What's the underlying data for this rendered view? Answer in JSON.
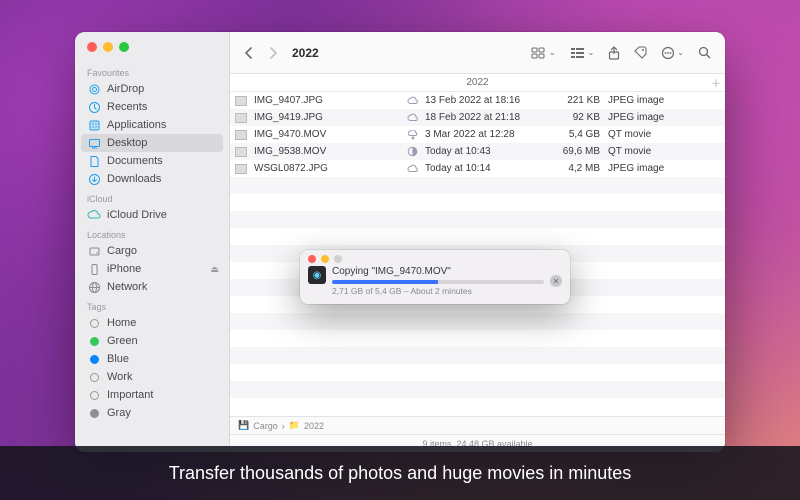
{
  "caption": "Transfer thousands of photos and huge movies in minutes",
  "window": {
    "title": "2022",
    "column_header": "2022"
  },
  "sidebar": {
    "sections": {
      "favourites": "Favourites",
      "icloud": "iCloud",
      "locations": "Locations",
      "tags": "Tags"
    },
    "favourites": [
      {
        "label": "AirDrop",
        "icon": "airdrop",
        "color": "#1a9ff1"
      },
      {
        "label": "Recents",
        "icon": "clock",
        "color": "#1a9ff1"
      },
      {
        "label": "Applications",
        "icon": "apps",
        "color": "#1a9ff1"
      },
      {
        "label": "Desktop",
        "icon": "desktop",
        "color": "#1a9ff1",
        "selected": true
      },
      {
        "label": "Documents",
        "icon": "doc",
        "color": "#1a9ff1"
      },
      {
        "label": "Downloads",
        "icon": "download",
        "color": "#1a9ff1"
      }
    ],
    "icloud": [
      {
        "label": "iCloud Drive",
        "icon": "cloud",
        "color": "#27b8b0"
      }
    ],
    "locations": [
      {
        "label": "Cargo",
        "icon": "disk",
        "color": "#8a8a8e"
      },
      {
        "label": "iPhone",
        "icon": "phone",
        "color": "#8a8a8e",
        "eject": true
      },
      {
        "label": "Network",
        "icon": "globe",
        "color": "#8a8a8e"
      }
    ],
    "tags": [
      {
        "label": "Home",
        "color": "transparent"
      },
      {
        "label": "Green",
        "color": "#34c759"
      },
      {
        "label": "Blue",
        "color": "#0a84ff"
      },
      {
        "label": "Work",
        "color": "transparent"
      },
      {
        "label": "Important",
        "color": "transparent"
      },
      {
        "label": "Gray",
        "color": "#8e8e93"
      }
    ]
  },
  "files": [
    {
      "name": "IMG_9407.JPG",
      "cloud": "cloud",
      "date": "13 Feb 2022 at 18:16",
      "size": "221 KB",
      "kind": "JPEG image"
    },
    {
      "name": "IMG_9419.JPG",
      "cloud": "cloud",
      "date": "18 Feb 2022 at 21:18",
      "size": "92 KB",
      "kind": "JPEG image"
    },
    {
      "name": "IMG_9470.MOV",
      "cloud": "down",
      "date": "3 Mar 2022 at 12:28",
      "size": "5,4 GB",
      "kind": "QT movie"
    },
    {
      "name": "IMG_9538.MOV",
      "cloud": "half",
      "date": "Today at 10:43",
      "size": "69,6 MB",
      "kind": "QT movie"
    },
    {
      "name": "WSGL0872.JPG",
      "cloud": "cloud",
      "date": "Today at 10:14",
      "size": "4,2 MB",
      "kind": "JPEG image"
    }
  ],
  "pathbar": {
    "seg1": "Cargo",
    "seg2": "2022"
  },
  "statusbar": "9 items, 24,48 GB available",
  "copy": {
    "title": "Copying \"IMG_9470.MOV\"",
    "subtitle": "2,71 GB of 5,4 GB – About 2 minutes",
    "progress_pct": 50
  }
}
